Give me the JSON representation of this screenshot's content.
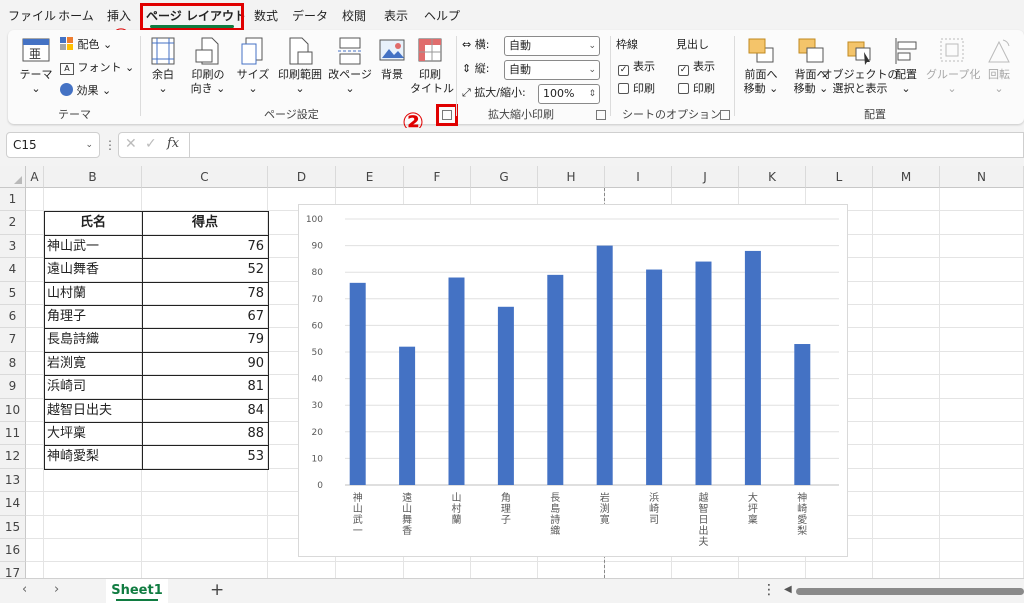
{
  "tabs": [
    "ファイル",
    "ホーム",
    "挿入",
    "ページ レイアウト",
    "数式",
    "データ",
    "校閲",
    "表示",
    "ヘルプ"
  ],
  "annotations": {
    "step1": "①",
    "step2": "②"
  },
  "ribbon": {
    "theme": {
      "theme_btn": "テーマ",
      "colors": "配色",
      "fonts": "フォント",
      "effects": "効果",
      "group_label": "テーマ"
    },
    "page_setup": {
      "margins": "余白",
      "orientation_l1": "印刷の",
      "orientation_l2": "向き",
      "size": "サイズ",
      "print_area": "印刷範囲",
      "breaks": "改ページ",
      "background": "背景",
      "print_titles_l1": "印刷",
      "print_titles_l2": "タイトル",
      "group_label": "ページ設定"
    },
    "scale": {
      "width_label": "横:",
      "width_value": "自動",
      "height_label": "縦:",
      "height_value": "自動",
      "scale_label": "拡大/縮小:",
      "scale_value": "100%",
      "group_label": "拡大縮小印刷"
    },
    "sheet_options": {
      "gridlines": "枠線",
      "headings": "見出し",
      "view": "表示",
      "print": "印刷",
      "group_label": "シートのオプション"
    },
    "arrange": {
      "bring_forward_l1": "前面へ",
      "bring_forward_l2": "移動",
      "send_backward_l1": "背面へ",
      "send_backward_l2": "移動",
      "selection_pane_l1": "オブジェクトの",
      "selection_pane_l2": "選択と表示",
      "align": "配置",
      "group": "グループ化",
      "rotate": "回転",
      "group_label": "配置"
    }
  },
  "formula_bar": {
    "name_box": "C15",
    "fx": "fx",
    "value": ""
  },
  "columns": [
    "A",
    "B",
    "C",
    "D",
    "E",
    "F",
    "G",
    "H",
    "I",
    "J",
    "K",
    "L",
    "M",
    "N"
  ],
  "rows": [
    "1",
    "2",
    "3",
    "4",
    "5",
    "6",
    "7",
    "8",
    "9",
    "10",
    "11",
    "12",
    "13",
    "14",
    "15",
    "16",
    "17"
  ],
  "table": {
    "headers": [
      "氏名",
      "得点"
    ],
    "names": [
      "神山武一",
      "遠山舞香",
      "山村蘭",
      "角理子",
      "長島詩織",
      "岩渕寛",
      "浜崎司",
      "越智日出夫",
      "大坪稟",
      "神崎愛梨"
    ],
    "scores": [
      "76",
      "52",
      "78",
      "67",
      "79",
      "90",
      "81",
      "84",
      "88",
      "53"
    ]
  },
  "chart_data": {
    "type": "bar",
    "categories": [
      "神山武一",
      "遠山舞香",
      "山村蘭",
      "角理子",
      "長島詩織",
      "岩渕寛",
      "浜崎司",
      "越智日出夫",
      "大坪稟",
      "神崎愛梨"
    ],
    "values": [
      76,
      52,
      78,
      67,
      79,
      90,
      81,
      84,
      88,
      53
    ],
    "title": "",
    "xlabel": "",
    "ylabel": "",
    "ylim": [
      0,
      100
    ],
    "yticks": [
      0,
      10,
      20,
      30,
      40,
      50,
      60,
      70,
      80,
      90,
      100
    ],
    "grid": true,
    "bar_color": "#4472c4"
  },
  "sheet_tabs": {
    "active": "Sheet1",
    "add": "+"
  },
  "colors": {
    "accent": "#107c41",
    "highlight": "#e00000",
    "bar": "#4472c4"
  }
}
